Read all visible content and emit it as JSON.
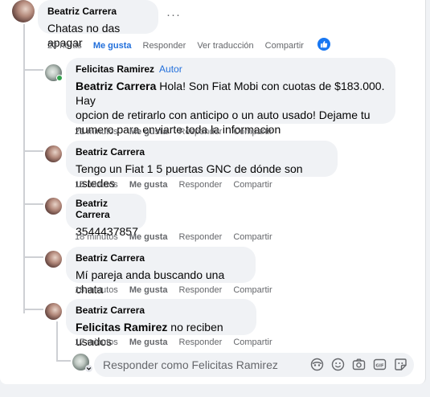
{
  "main_comment": {
    "author": "Beatriz Carrera",
    "text": "Chatas no das apagar",
    "time": "23 horas",
    "like": "Me gusta",
    "reply": "Responder",
    "translate": "Ver traducción",
    "share": "Compartir"
  },
  "replies": [
    {
      "author": "Felicitas Ramirez",
      "badge": "Autor",
      "mention": "Beatriz Carrera",
      "line1": " Hola! Son Fiat Mobi con cuotas de $183.000. Hay",
      "line2": "opcion de retirarlo con anticipo o un auto usado! Dejame tu",
      "line3": "numero para enviarte toda la informacion",
      "time": "21 minutos",
      "like": "Me gusta",
      "reply": "Responder",
      "share": "Compartir"
    },
    {
      "author": "Beatriz Carrera",
      "text": "Tengo un Fiat 1 5 puertas GNC de dónde son ustedes",
      "time": "18 minutos",
      "like": "Me gusta",
      "reply": "Responder",
      "share": "Compartir"
    },
    {
      "author": "Beatriz Carrera",
      "text": "3544437857",
      "time": "18 minutos",
      "like": "Me gusta",
      "reply": "Responder",
      "share": "Compartir"
    },
    {
      "author": "Beatriz Carrera",
      "text": "Mí pareja anda buscando una chata",
      "time": "18 minutos",
      "like": "Me gusta",
      "reply": "Responder",
      "share": "Compartir"
    },
    {
      "author": "Beatriz Carrera",
      "mention": "Felicitas Ramirez",
      "text": " no reciben usados",
      "time": "17 minutos",
      "like": "Me gusta",
      "reply": "Responder",
      "share": "Compartir"
    }
  ],
  "composer": {
    "placeholder": "Responder como Felicitas Ramirez",
    "icons": [
      "avatar-sticker-icon",
      "emoji-icon",
      "camera-icon",
      "gif-icon",
      "sticker-icon"
    ]
  },
  "colors": {
    "accent": "#216fdb",
    "like_badge": "#1877f2",
    "bubble": "#f0f2f5",
    "meta": "#65676b",
    "online": "#31a24c"
  }
}
